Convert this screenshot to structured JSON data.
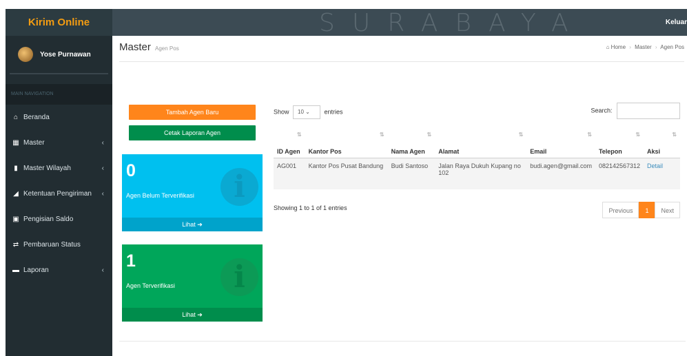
{
  "header": {
    "brand": "Kirim Online",
    "watermark": "SURABAYA",
    "logout": "Keluar"
  },
  "sidebar": {
    "user_name": "Yose Purnawan",
    "nav_header": "MAIN NAVIGATION",
    "items": [
      {
        "label": "Beranda",
        "icon": "home-icon",
        "glyph": "⌂",
        "chevron": false
      },
      {
        "label": "Master",
        "icon": "table-icon",
        "glyph": "▦",
        "chevron": true
      },
      {
        "label": "Master Wilayah",
        "icon": "map-icon",
        "glyph": "▮",
        "chevron": true
      },
      {
        "label": "Ketentuan Pengiriman",
        "icon": "send-icon",
        "glyph": "◢",
        "chevron": true
      },
      {
        "label": "Pengisian Saldo",
        "icon": "money-icon",
        "glyph": "▣",
        "chevron": false
      },
      {
        "label": "Pembaruan Status",
        "icon": "exchange-icon",
        "glyph": "⇄",
        "chevron": false
      },
      {
        "label": "Laporan",
        "icon": "folder-icon",
        "glyph": "▬",
        "chevron": true
      }
    ]
  },
  "page": {
    "title": "Master",
    "subtitle": "Agen Pos"
  },
  "breadcrumb": {
    "home": "Home",
    "master": "Master",
    "current": "Agen Pos"
  },
  "buttons": {
    "add": "Tambah Agen Baru",
    "print": "Cetak Laporan Agen"
  },
  "boxes": {
    "unverified": {
      "count": "0",
      "label": "Agen Belum Terverifikasi",
      "link": "Lihat"
    },
    "verified": {
      "count": "1",
      "label": "Agen Terverifikasi",
      "link": "Lihat"
    }
  },
  "table_controls": {
    "show": "Show",
    "entries_value": "10",
    "entries": "entries",
    "search": "Search:"
  },
  "table": {
    "headers": [
      "ID Agen",
      "Kantor Pos",
      "Nama Agen",
      "Alamat",
      "Email",
      "Telepon",
      "Aksi"
    ],
    "rows": [
      {
        "id": "AG001",
        "kantor": "Kantor Pos Pusat Bandung",
        "nama": "Budi Santoso",
        "alamat": "Jalan Raya Dukuh Kupang no 102",
        "email": "budi.agen@gmail.com",
        "telepon": "082142567312",
        "aksi": "Detail"
      }
    ],
    "info": "Showing 1 to 1 of 1 entries"
  },
  "pagination": {
    "previous": "Previous",
    "page": "1",
    "next": "Next"
  },
  "colors": {
    "orange": "#ff851b",
    "green": "#008d4c",
    "blue": "#00c0ef",
    "sidebar": "#222d32"
  }
}
